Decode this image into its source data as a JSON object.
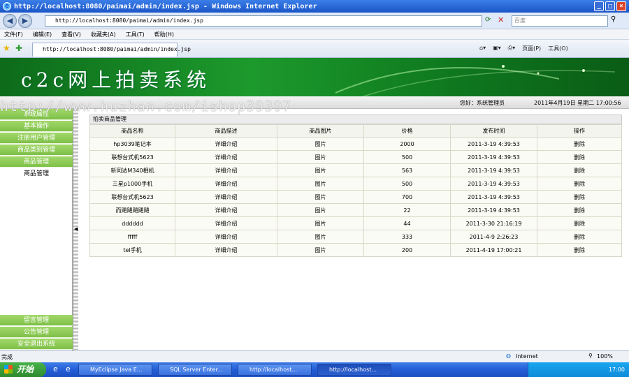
{
  "window": {
    "title": "http://localhost:8080/paimai/admin/index.jsp - Windows Internet Explorer",
    "minimize": "_",
    "maximize": "□",
    "close": "×"
  },
  "address": {
    "url": "http://localhost:8080/paimai/admin/index.jsp",
    "search_placeholder": "百度"
  },
  "menu": [
    "文件(F)",
    "编辑(E)",
    "查看(V)",
    "收藏夹(A)",
    "工具(T)",
    "帮助(H)"
  ],
  "favbar": {
    "tab_title": "http://localhost:8080/paimai/admin/index.jsp",
    "page_label": "页面(P)",
    "tools_label": "工具(O)"
  },
  "banner": {
    "title": "c2c网上拍卖系统"
  },
  "watermark": "http://www.huzhan.com/ishop39397",
  "infobar": {
    "greeting": "您好：系统管理员",
    "datetime": "2011年4月19日 星期二 17:00:56"
  },
  "sidebar": {
    "top_items": [
      "系统属性",
      "基本操作",
      "注册用户管理",
      "商品类别管理",
      "商品管理"
    ],
    "sub_item": "商品管理",
    "bottom_items": [
      "留言管理",
      "公告管理",
      "安全退出系统"
    ],
    "splitter_arrow": "◀"
  },
  "main": {
    "panel_title": "拍卖商品管理",
    "columns": [
      "商品名称",
      "商品描述",
      "商品图片",
      "价格",
      "发布时间",
      "操作"
    ],
    "rows": [
      [
        "hp3039笔记本",
        "详细介绍",
        "图片",
        "2000",
        "2011-3-19 4:39:53",
        "删除"
      ],
      [
        "联想台式机5623",
        "详细介绍",
        "图片",
        "500",
        "2011-3-19 4:39:53",
        "删除"
      ],
      [
        "新同达M340相机",
        "详细介绍",
        "图片",
        "563",
        "2011-3-19 4:39:53",
        "删除"
      ],
      [
        "三星p1000手机",
        "详细介绍",
        "图片",
        "500",
        "2011-3-19 4:39:53",
        "删除"
      ],
      [
        "联想台式机5623",
        "详细介绍",
        "图片",
        "700",
        "2011-3-19 4:39:53",
        "删除"
      ],
      [
        "而飓飓飓飓飓",
        "详细介绍",
        "图片",
        "22",
        "2011-3-19 4:39:53",
        "删除"
      ],
      [
        "dddddd",
        "详细介绍",
        "图片",
        "44",
        "2011-3-30 21:16:19",
        "删除"
      ],
      [
        "fffff",
        "详细介绍",
        "图片",
        "333",
        "2011-4-9 2:26:23",
        "删除"
      ],
      [
        "tel手机",
        "详细介绍",
        "图片",
        "200",
        "2011-4-19 17:00:21",
        "删除"
      ]
    ]
  },
  "statusbar": {
    "left": "完成",
    "zone": "Internet",
    "zoom": "100%"
  },
  "taskbar": {
    "start": "开始",
    "tasks": [
      "MyEclipse Java E...",
      "SQL Server Enter...",
      "http://localhost...",
      "http://localhost..."
    ],
    "clock": "17:00"
  }
}
